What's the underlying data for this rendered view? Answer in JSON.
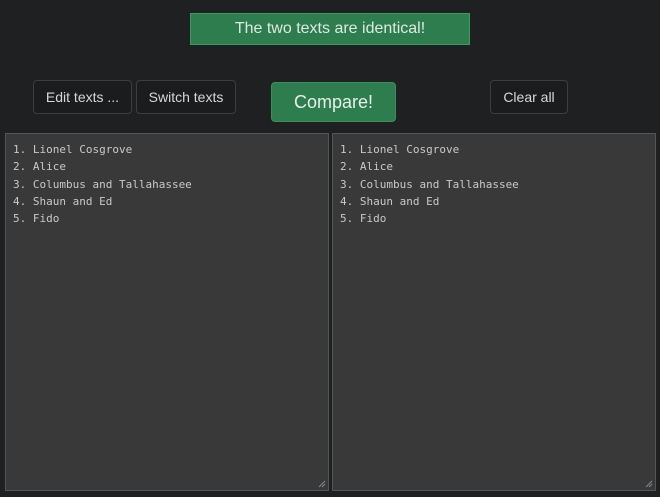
{
  "banner": {
    "message": "The two texts are identical!"
  },
  "toolbar": {
    "edit_label": "Edit texts ...",
    "switch_label": "Switch texts",
    "compare_label": "Compare!",
    "clear_label": "Clear all"
  },
  "left_text": {
    "lines": [
      "1. Lionel Cosgrove",
      "2. Alice",
      "3. Columbus and Tallahassee",
      "4. Shaun and Ed",
      "5. Fido"
    ]
  },
  "right_text": {
    "lines": [
      "1. Lionel Cosgrove",
      "2. Alice",
      "3. Columbus and Tallahassee",
      "4. Shaun and Ed",
      "5. Fido"
    ]
  },
  "colors": {
    "accent_green": "#2e7d4f",
    "background": "#1f2022",
    "textarea_bg": "#393939"
  }
}
